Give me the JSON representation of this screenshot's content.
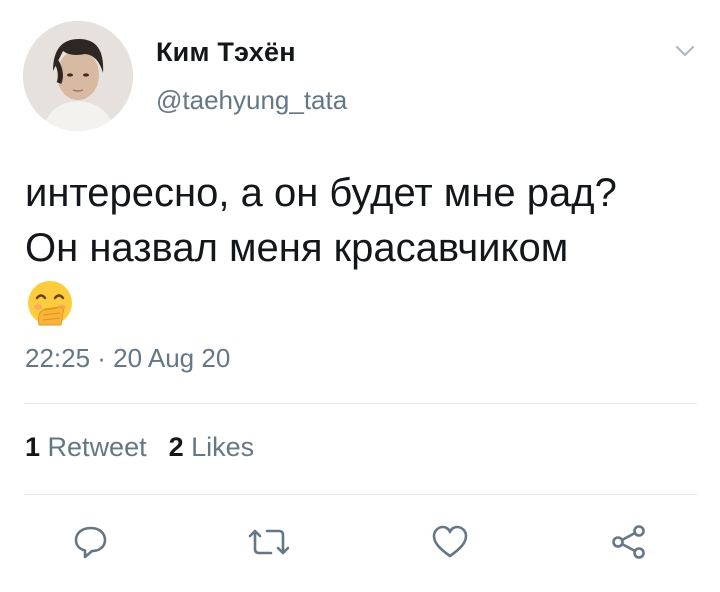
{
  "user": {
    "display_name": "Ким Тэхён",
    "handle": "@taehyung_tata"
  },
  "tweet": {
    "text_lines": [
      "интересно, а он будет мне рад?",
      "Он назвал меня красавчиком"
    ],
    "emoji": "hand-over-mouth-emoji",
    "timestamp": "22:25 · 20 Aug 20"
  },
  "stats": {
    "retweets_count": "1",
    "retweets_label": "Retweet",
    "likes_count": "2",
    "likes_label": "Likes"
  },
  "actions": [
    "reply-icon",
    "retweet-icon",
    "like-icon",
    "share-icon"
  ],
  "colors": {
    "text": "#14171a",
    "secondary": "#657786",
    "divider": "#e1e8ed",
    "icon": "#657786"
  }
}
